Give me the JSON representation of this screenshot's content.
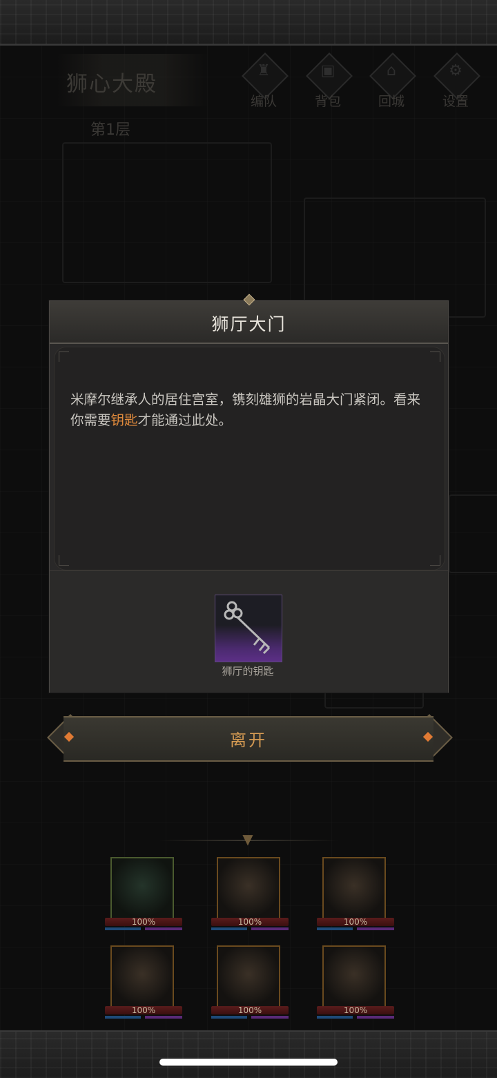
{
  "location": {
    "name": "狮心大殿",
    "floor": "第1层"
  },
  "menu": [
    {
      "label": "编队",
      "icon": "horned-helmet-icon"
    },
    {
      "label": "背包",
      "icon": "backpack-icon"
    },
    {
      "label": "回城",
      "icon": "town-portal-icon"
    },
    {
      "label": "设置",
      "icon": "gear-icon"
    }
  ],
  "dialog": {
    "title": "狮厅大门",
    "desc_before": "米摩尔继承人的居住宫室，镌刻雄狮的岩晶大门紧闭。看来你需要",
    "desc_highlight": "钥匙",
    "desc_after": "才能通过此处。",
    "highlight_color": "#e08a3c",
    "item": {
      "name": "狮厅的钥匙",
      "icon": "key-icon",
      "rarity_color": "#5c2f86"
    }
  },
  "leave_button": {
    "label": "离开"
  },
  "party": [
    {
      "hp": "100%"
    },
    {
      "hp": "100%"
    },
    {
      "hp": "100%"
    },
    {
      "hp": "100%"
    },
    {
      "hp": "100%"
    },
    {
      "hp": "100%"
    }
  ]
}
